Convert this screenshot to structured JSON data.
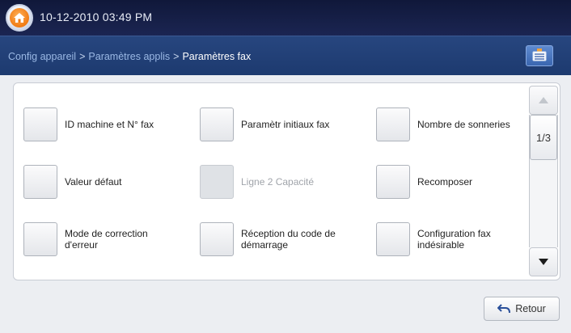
{
  "status": {
    "datetime": "10-12-2010 03:49 PM"
  },
  "breadcrumb": {
    "items": [
      "Config appareil",
      "Paramètres applis",
      "Paramètres fax"
    ],
    "separator": ">"
  },
  "grid": {
    "items": [
      {
        "label": "ID machine et N° fax",
        "enabled": true
      },
      {
        "label": "Paramètr initiaux fax",
        "enabled": true
      },
      {
        "label": "Nombre de sonneries",
        "enabled": true
      },
      {
        "label": "Valeur défaut",
        "enabled": true
      },
      {
        "label": "Ligne 2 Capacité",
        "enabled": false
      },
      {
        "label": "Recomposer",
        "enabled": true
      },
      {
        "label": "Mode de correction d'erreur",
        "enabled": true
      },
      {
        "label": "Réception du code de démarrage",
        "enabled": true
      },
      {
        "label": "Configuration fax indésirable",
        "enabled": true
      }
    ]
  },
  "pager": {
    "page_indicator": "1/3"
  },
  "footer": {
    "back_label": "Retour"
  },
  "colors": {
    "topbar": "#1b2552",
    "breadcrumb_bar": "#23427a",
    "content_bg": "#eceef2",
    "accent_home": "#f07a12"
  }
}
